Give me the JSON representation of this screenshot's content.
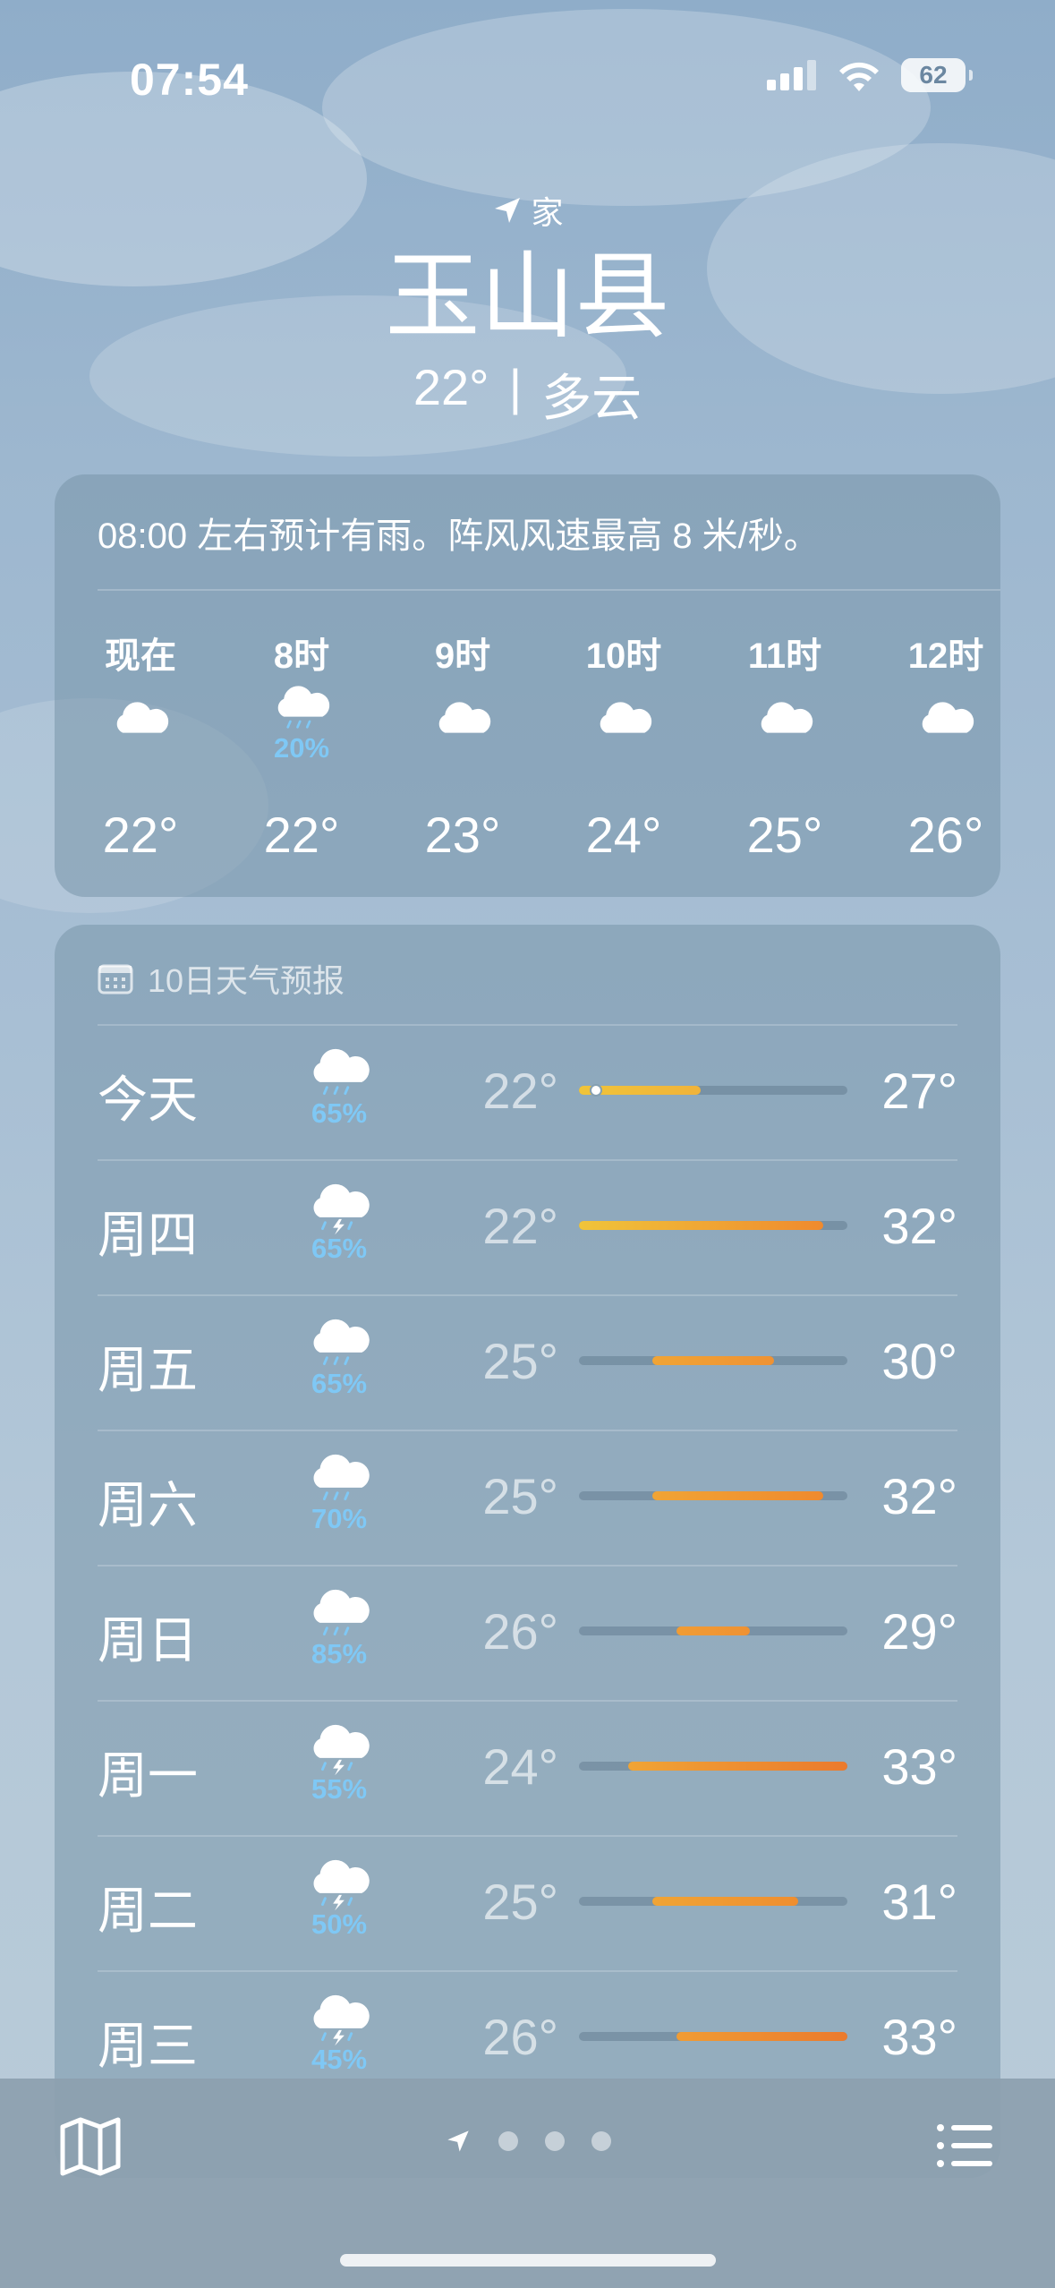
{
  "status_bar": {
    "time": "07:54",
    "battery": "62"
  },
  "location": {
    "tag": "家",
    "city": "玉山县",
    "temp": "22°",
    "separator": "|",
    "condition": "多云"
  },
  "hourly": {
    "summary": "08:00 左右预计有雨。阵风风速最高 8 米/秒。",
    "items": [
      {
        "label": "现在",
        "icon": "cloud-icon",
        "prob": "",
        "temp": "22°"
      },
      {
        "label": "8时",
        "icon": "cloud-rain-icon",
        "prob": "20%",
        "temp": "22°"
      },
      {
        "label": "9时",
        "icon": "cloud-icon",
        "prob": "",
        "temp": "23°"
      },
      {
        "label": "10时",
        "icon": "cloud-icon",
        "prob": "",
        "temp": "24°"
      },
      {
        "label": "11时",
        "icon": "cloud-icon",
        "prob": "",
        "temp": "25°"
      },
      {
        "label": "12时",
        "icon": "cloud-icon",
        "prob": "",
        "temp": "26°"
      }
    ]
  },
  "daily": {
    "title": "10日天气预报",
    "range_min": 22,
    "range_max": 33,
    "days": [
      {
        "name": "今天",
        "icon": "cloud-rain-icon",
        "prob": "65%",
        "low": "22°",
        "high": "27°",
        "low_val": 22,
        "high_val": 27,
        "current": 22,
        "colors": [
          "#f0c43a",
          "#f0b33a"
        ]
      },
      {
        "name": "周四",
        "icon": "cloud-bolt-icon",
        "prob": "65%",
        "low": "22°",
        "high": "32°",
        "low_val": 22,
        "high_val": 32,
        "colors": [
          "#f0c43a",
          "#ef8a2e"
        ]
      },
      {
        "name": "周五",
        "icon": "cloud-rain-icon",
        "prob": "65%",
        "low": "25°",
        "high": "30°",
        "low_val": 25,
        "high_val": 30,
        "colors": [
          "#f0a435",
          "#ef9233"
        ]
      },
      {
        "name": "周六",
        "icon": "cloud-rain-icon",
        "prob": "70%",
        "low": "25°",
        "high": "32°",
        "low_val": 25,
        "high_val": 32,
        "colors": [
          "#f0a435",
          "#ef8a2e"
        ]
      },
      {
        "name": "周日",
        "icon": "cloud-rain-icon",
        "prob": "85%",
        "low": "26°",
        "high": "29°",
        "low_val": 26,
        "high_val": 29,
        "colors": [
          "#f09c34",
          "#ef9233"
        ]
      },
      {
        "name": "周一",
        "icon": "cloud-bolt-icon",
        "prob": "55%",
        "low": "24°",
        "high": "33°",
        "low_val": 24,
        "high_val": 33,
        "colors": [
          "#f0a435",
          "#eb7a2d"
        ]
      },
      {
        "name": "周二",
        "icon": "cloud-bolt-icon",
        "prob": "50%",
        "low": "25°",
        "high": "31°",
        "low_val": 25,
        "high_val": 31,
        "colors": [
          "#f0a435",
          "#ef8e30"
        ]
      },
      {
        "name": "周三",
        "icon": "cloud-bolt-icon",
        "prob": "45%",
        "low": "26°",
        "high": "33°",
        "low_val": 26,
        "high_val": 33,
        "colors": [
          "#f09c34",
          "#eb7a2d"
        ]
      }
    ]
  }
}
